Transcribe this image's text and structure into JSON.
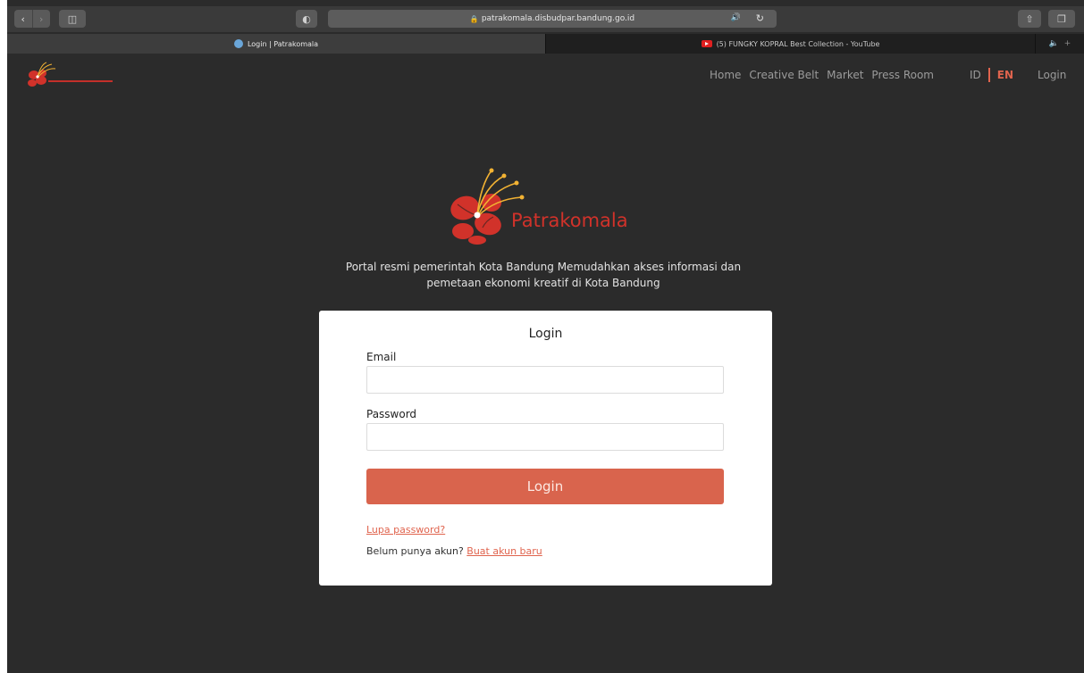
{
  "browser": {
    "url": "patrakomala.disbudpar.bandung.go.id",
    "tabs": [
      {
        "title": "Login | Patrakomala",
        "active": true
      },
      {
        "title": "(5) FUNGKY KOPRAL Best Collection - YouTube",
        "active": false
      }
    ]
  },
  "header": {
    "nav": [
      "Home",
      "Creative Belt",
      "Market",
      "Press Room"
    ],
    "lang_id": "ID",
    "lang_en": "EN",
    "login": "Login"
  },
  "hero": {
    "brand": "Patrakomala",
    "tagline_line1": "Portal resmi pemerintah Kota Bandung Memudahkan akses informasi dan",
    "tagline_line2": "pemetaan ekonomi kreatif di Kota Bandung"
  },
  "login_form": {
    "title": "Login",
    "email_label": "Email",
    "email_value": "",
    "password_label": "Password",
    "password_value": "",
    "submit_label": "Login",
    "forgot_label": "Lupa password?",
    "signup_prompt": "Belum punya akun?",
    "signup_link": "Buat akun baru"
  },
  "colors": {
    "accent": "#d9644d",
    "background": "#2b2b2b",
    "logo_red": "#d1322a",
    "logo_gold": "#f2b233"
  }
}
